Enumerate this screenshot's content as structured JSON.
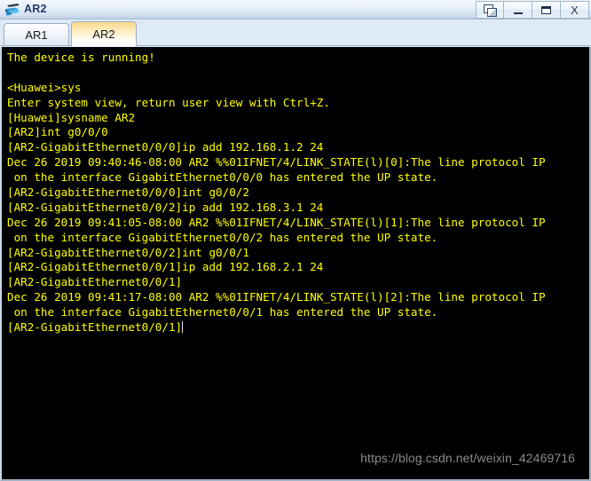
{
  "window": {
    "title": "AR2",
    "icon": "router-icon",
    "controls": [
      {
        "name": "restore-button",
        "label": "",
        "icon": "restore-icon"
      },
      {
        "name": "minimize-button",
        "label": "_",
        "icon": "minimize-icon"
      },
      {
        "name": "maximize-button",
        "label": "",
        "icon": "maximize-icon"
      },
      {
        "name": "close-button",
        "label": "X",
        "icon": "close-icon"
      }
    ]
  },
  "tabs": [
    {
      "label": "AR1",
      "active": false
    },
    {
      "label": "AR2",
      "active": true
    }
  ],
  "terminal": {
    "foreground_color": "#ffff00",
    "background_color": "#000000",
    "cursor_color": "#e8e8e8",
    "lines": [
      "The device is running!",
      "",
      "<Huawei>sys",
      "Enter system view, return user view with Ctrl+Z.",
      "[Huawei]sysname AR2",
      "[AR2]int g0/0/0",
      "[AR2-GigabitEthernet0/0/0]ip add 192.168.1.2 24",
      "Dec 26 2019 09:40:46-08:00 AR2 %%01IFNET/4/LINK_STATE(l)[0]:The line protocol IP",
      " on the interface GigabitEthernet0/0/0 has entered the UP state.",
      "[AR2-GigabitEthernet0/0/0]int g0/0/2",
      "[AR2-GigabitEthernet0/0/2]ip add 192.168.3.1 24",
      "Dec 26 2019 09:41:05-08:00 AR2 %%01IFNET/4/LINK_STATE(l)[1]:The line protocol IP",
      " on the interface GigabitEthernet0/0/2 has entered the UP state.",
      "[AR2-GigabitEthernet0/0/2]int g0/0/1",
      "[AR2-GigabitEthernet0/0/1]ip add 192.168.2.1 24",
      "[AR2-GigabitEthernet0/0/1]",
      "Dec 26 2019 09:41:17-08:00 AR2 %%01IFNET/4/LINK_STATE(l)[2]:The line protocol IP",
      " on the interface GigabitEthernet0/0/1 has entered the UP state.",
      "[AR2-GigabitEthernet0/0/1]"
    ],
    "cursor_line_index": 18
  },
  "watermark": {
    "text": "https://blog.csdn.net/weixin_42469716"
  }
}
